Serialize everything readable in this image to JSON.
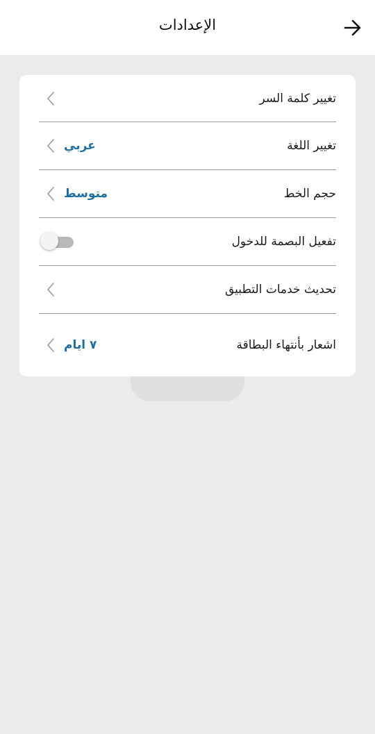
{
  "header": {
    "title": "الإعدادات",
    "back_icon": "arrow-right-icon"
  },
  "settings": {
    "items": [
      {
        "label": "تغيير كلمة السر",
        "value": "",
        "control": "chevron"
      },
      {
        "label": "تغيير اللغة",
        "value": "عربي",
        "control": "chevron"
      },
      {
        "label": "حجم الخط",
        "value": "متوسط",
        "control": "chevron"
      },
      {
        "label": "تفعيل البصمة للدخول",
        "value": "",
        "control": "toggle",
        "toggle_on": false
      },
      {
        "label": "تحديث خدمات التطبيق",
        "value": "",
        "control": "chevron"
      },
      {
        "label": "اشعار بأنتهاء البطاقة",
        "value": "٧ ايام",
        "control": "chevron"
      }
    ]
  },
  "colors": {
    "background": "#ebebeb",
    "card": "#ffffff",
    "accent_value": "#1d6fa0",
    "divider": "#9a9a9a"
  }
}
